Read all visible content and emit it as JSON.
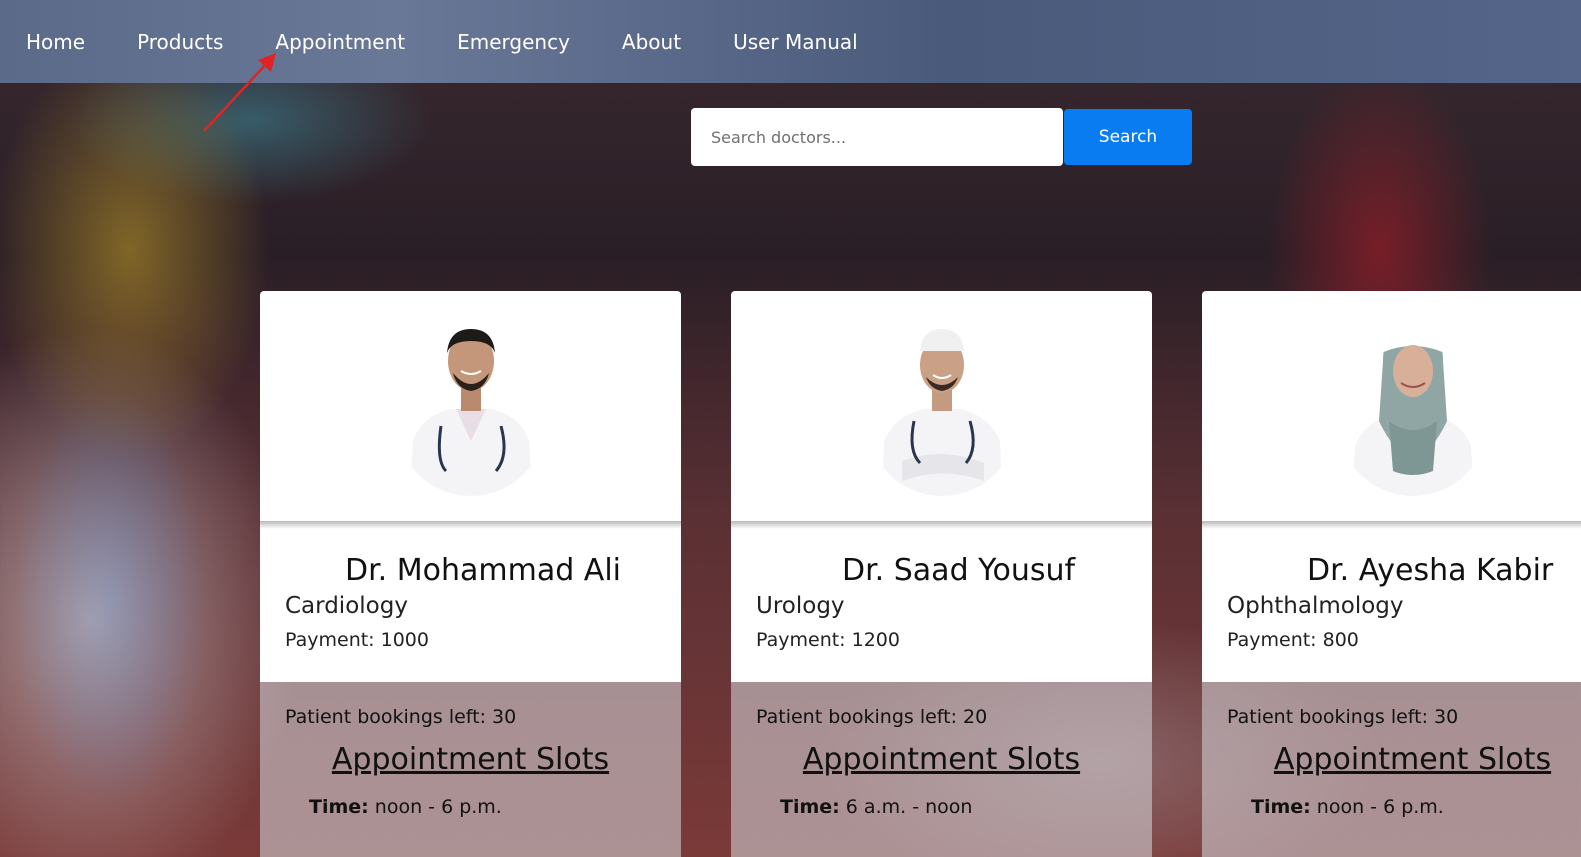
{
  "nav": {
    "items": [
      {
        "label": "Home"
      },
      {
        "label": "Products"
      },
      {
        "label": "Appointment"
      },
      {
        "label": "Emergency"
      },
      {
        "label": "About"
      },
      {
        "label": "User Manual"
      }
    ]
  },
  "search": {
    "placeholder": "Search doctors...",
    "button_label": "Search",
    "button_color": "#0a7cf2"
  },
  "doctors": [
    {
      "name": "Dr. Mohammad Ali",
      "specialty": "Cardiology",
      "payment": "Payment: 1000",
      "bookings": "Patient bookings left: 30",
      "slots_title": "Appointment Slots",
      "time_label": "Time:",
      "time_value": " noon - 6 p.m."
    },
    {
      "name": "Dr. Saad Yousuf",
      "specialty": "Urology",
      "payment": "Payment: 1200",
      "bookings": "Patient bookings left: 20",
      "slots_title": "Appointment Slots",
      "time_label": "Time:",
      "time_value": " 6 a.m. - noon"
    },
    {
      "name": "Dr. Ayesha Kabir",
      "specialty": "Ophthalmology",
      "payment": "Payment: 800",
      "bookings": "Patient bookings left: 30",
      "slots_title": "Appointment Slots",
      "time_label": "Time:",
      "time_value": " noon - 6 p.m."
    }
  ]
}
